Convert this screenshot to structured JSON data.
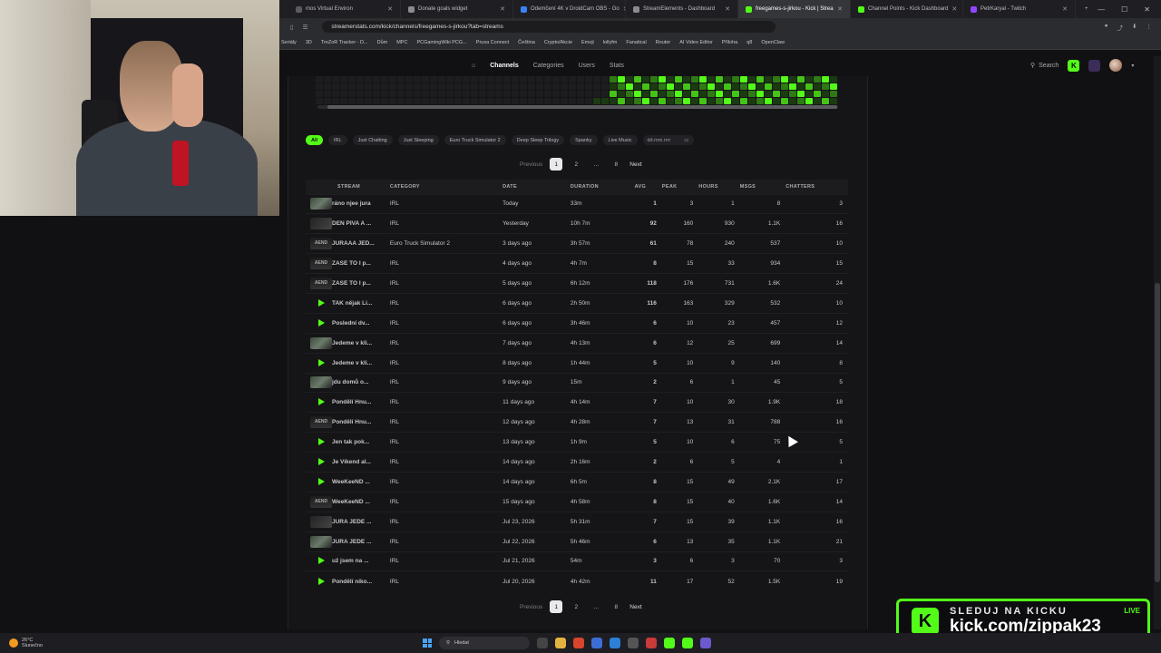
{
  "browser": {
    "tabs": [
      {
        "label": "mos Virtual Environ",
        "color": "#5a5a60"
      },
      {
        "label": "Donate goals widget",
        "color": "#8a8a90"
      },
      {
        "label": "Odemčení 4K v DroidCam OBS - Go",
        "color": "#3b82f6"
      },
      {
        "label": "StreamElements - Dashboard",
        "color": "#8a8a90"
      },
      {
        "label": "freegames-s-jirkou - Kick | Strea",
        "color": "#53fc18",
        "active": true
      },
      {
        "label": "Channel Points - Kick Dashboard",
        "color": "#53fc18"
      },
      {
        "label": "PetrKaryal - Twitch",
        "color": "#9146ff"
      }
    ],
    "url": "streamerstats.com/kick/channels/freegames-s-jirkou?tab=streams",
    "bookmarks": [
      "Seriály",
      "3D",
      "TreZoR Tracker - D...",
      "Dům",
      "MPC",
      "PCGamingWiki PCG...",
      "Prusa Connect",
      "Čeština",
      "Crypto/Akcie",
      "Emoji",
      "lollyfm",
      "Fanatical",
      "Router",
      "AI Video Editor",
      "Příloha",
      "q8",
      "OpenClaw"
    ]
  },
  "sitenav": {
    "links": [
      "Channels",
      "Categories",
      "Users",
      "Stats"
    ],
    "active": "Channels",
    "search_label": "Search",
    "kick_letter": "K"
  },
  "filters": {
    "chips": [
      "All",
      "IRL",
      "Just Chatting",
      "Just Sleeping",
      "Euro Truck Simulator 2",
      "Deep Sleep Trilogy",
      "Spanky",
      "Live Music"
    ],
    "active": "All",
    "date_placeholder": "dd.mm.rrrr"
  },
  "pager": {
    "previous": "Previous",
    "pages": [
      "1",
      "2",
      "...",
      "8"
    ],
    "current": "1",
    "next": "Next"
  },
  "table": {
    "columns": [
      "STREAM",
      "CATEGORY",
      "DATE",
      "DURATION",
      "AVG",
      "PEAK",
      "HOURS",
      "MSGS",
      "CHATTERS"
    ],
    "rows": [
      {
        "thumb": "img",
        "stream": "ráno njee jura",
        "category": "IRL",
        "date": "Today",
        "duration": "33m",
        "avg": "1",
        "peak": "3",
        "hours": "1",
        "msgs": "8",
        "chatters": "3"
      },
      {
        "thumb": "dark",
        "stream": "DEN PIVA A ...",
        "category": "IRL",
        "date": "Yesterday",
        "duration": "10h 7m",
        "avg": "92",
        "peak": "160",
        "hours": "930",
        "msgs": "1.1K",
        "chatters": "16"
      },
      {
        "thumb": "end",
        "stream": "JURAAA JED...",
        "category": "Euro Truck Simulator 2",
        "date": "3 days ago",
        "duration": "3h 57m",
        "avg": "61",
        "peak": "78",
        "hours": "240",
        "msgs": "537",
        "chatters": "10"
      },
      {
        "thumb": "end",
        "stream": "ZASE TO I p...",
        "category": "IRL",
        "date": "4 days ago",
        "duration": "4h 7m",
        "avg": "8",
        "peak": "15",
        "hours": "33",
        "msgs": "934",
        "chatters": "15"
      },
      {
        "thumb": "end",
        "stream": "ZASE TO I p...",
        "category": "IRL",
        "date": "5 days ago",
        "duration": "6h 12m",
        "avg": "118",
        "peak": "176",
        "hours": "731",
        "msgs": "1.6K",
        "chatters": "24"
      },
      {
        "thumb": "play",
        "stream": "TAK nějak Li...",
        "category": "IRL",
        "date": "6 days ago",
        "duration": "2h 50m",
        "avg": "116",
        "peak": "163",
        "hours": "329",
        "msgs": "532",
        "chatters": "10"
      },
      {
        "thumb": "play",
        "stream": "Poslední dv...",
        "category": "IRL",
        "date": "6 days ago",
        "duration": "3h 46m",
        "avg": "6",
        "peak": "10",
        "hours": "23",
        "msgs": "457",
        "chatters": "12"
      },
      {
        "thumb": "img",
        "stream": "Jedeme v kli...",
        "category": "IRL",
        "date": "7 days ago",
        "duration": "4h 13m",
        "avg": "6",
        "peak": "12",
        "hours": "25",
        "msgs": "699",
        "chatters": "14"
      },
      {
        "thumb": "play",
        "stream": "Jedeme v kli...",
        "category": "IRL",
        "date": "8 days ago",
        "duration": "1h 44m",
        "avg": "5",
        "peak": "10",
        "hours": "9",
        "msgs": "140",
        "chatters": "8"
      },
      {
        "thumb": "img",
        "stream": "jdu domů o...",
        "category": "IRL",
        "date": "9 days ago",
        "duration": "15m",
        "avg": "2",
        "peak": "6",
        "hours": "1",
        "msgs": "45",
        "chatters": "5"
      },
      {
        "thumb": "play",
        "stream": "Pondělí Hnu...",
        "category": "IRL",
        "date": "11 days ago",
        "duration": "4h 14m",
        "avg": "7",
        "peak": "10",
        "hours": "30",
        "msgs": "1.9K",
        "chatters": "18"
      },
      {
        "thumb": "end",
        "stream": "Pondělí Hnu...",
        "category": "IRL",
        "date": "12 days ago",
        "duration": "4h 28m",
        "avg": "7",
        "peak": "13",
        "hours": "31",
        "msgs": "788",
        "chatters": "16"
      },
      {
        "thumb": "play",
        "stream": "Jen tak pok...",
        "category": "IRL",
        "date": "13 days ago",
        "duration": "1h 9m",
        "avg": "5",
        "peak": "10",
        "hours": "6",
        "msgs": "75",
        "chatters": "5"
      },
      {
        "thumb": "play",
        "stream": "Je Víkend al...",
        "category": "IRL",
        "date": "14 days ago",
        "duration": "2h 16m",
        "avg": "2",
        "peak": "6",
        "hours": "5",
        "msgs": "4",
        "chatters": "1"
      },
      {
        "thumb": "play",
        "stream": "WeeKeeND ...",
        "category": "IRL",
        "date": "14 days ago",
        "duration": "6h 5m",
        "avg": "8",
        "peak": "15",
        "hours": "49",
        "msgs": "2.1K",
        "chatters": "17"
      },
      {
        "thumb": "end",
        "stream": "WeeKeeND ...",
        "category": "IRL",
        "date": "15 days ago",
        "duration": "4h 58m",
        "avg": "8",
        "peak": "15",
        "hours": "40",
        "msgs": "1.6K",
        "chatters": "14"
      },
      {
        "thumb": "dark",
        "stream": "JURA JEDE ...",
        "category": "IRL",
        "date": "Jul 23, 2026",
        "duration": "5h 31m",
        "avg": "7",
        "peak": "15",
        "hours": "39",
        "msgs": "1.1K",
        "chatters": "16"
      },
      {
        "thumb": "img",
        "stream": "JURA JEDE ...",
        "category": "IRL",
        "date": "Jul 22, 2026",
        "duration": "5h 46m",
        "avg": "6",
        "peak": "13",
        "hours": "35",
        "msgs": "1.1K",
        "chatters": "21"
      },
      {
        "thumb": "play",
        "stream": "už jsem na ...",
        "category": "IRL",
        "date": "Jul 21, 2026",
        "duration": "54m",
        "avg": "3",
        "peak": "6",
        "hours": "3",
        "msgs": "70",
        "chatters": "3"
      },
      {
        "thumb": "play",
        "stream": "Pondělí niko...",
        "category": "IRL",
        "date": "Jul 20, 2026",
        "duration": "4h 42m",
        "avg": "11",
        "peak": "17",
        "hours": "52",
        "msgs": "1.5K",
        "chatters": "19"
      }
    ]
  },
  "promo": {
    "line1": "SLEDUJ NA KICKU",
    "line2": "kick.com/zippak23",
    "live": "LIVE",
    "k": "K"
  },
  "taskbar": {
    "temp": "26°C",
    "weather": "Slunečno",
    "search_placeholder": "Hledat"
  },
  "colors": {
    "accent": "#53fc18",
    "background": "#111113"
  }
}
